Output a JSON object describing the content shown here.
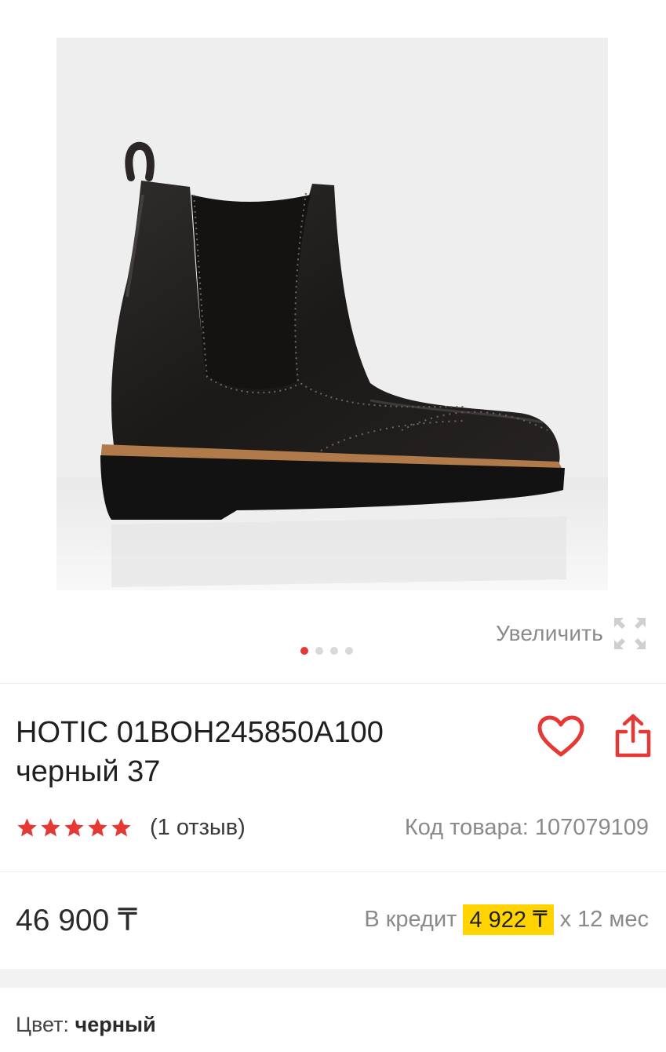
{
  "gallery": {
    "zoom_label": "Увеличить",
    "zoom_icon": "expand-arrows-icon",
    "slides_count": 4,
    "active_slide": 1
  },
  "product": {
    "title_line1": "HOTIC 01BOH245850A100",
    "title_line2": "черный 37",
    "favorite_icon": "heart-outline-icon",
    "share_icon": "share-icon",
    "rating": 5,
    "reviews_label": "(1 отзыв)",
    "sku_label": "Код товара: 107079109"
  },
  "pricing": {
    "price": "46 900 ₸",
    "credit_prefix": "В кредит",
    "credit_amount": "4 922 ₸",
    "credit_suffix": "х 12 мес"
  },
  "attributes": {
    "color_label": "Цвет:",
    "color_value": "черный"
  },
  "colors": {
    "accent": "#e53935",
    "highlight": "#ffd400",
    "muted_text": "#8a8a8a"
  }
}
